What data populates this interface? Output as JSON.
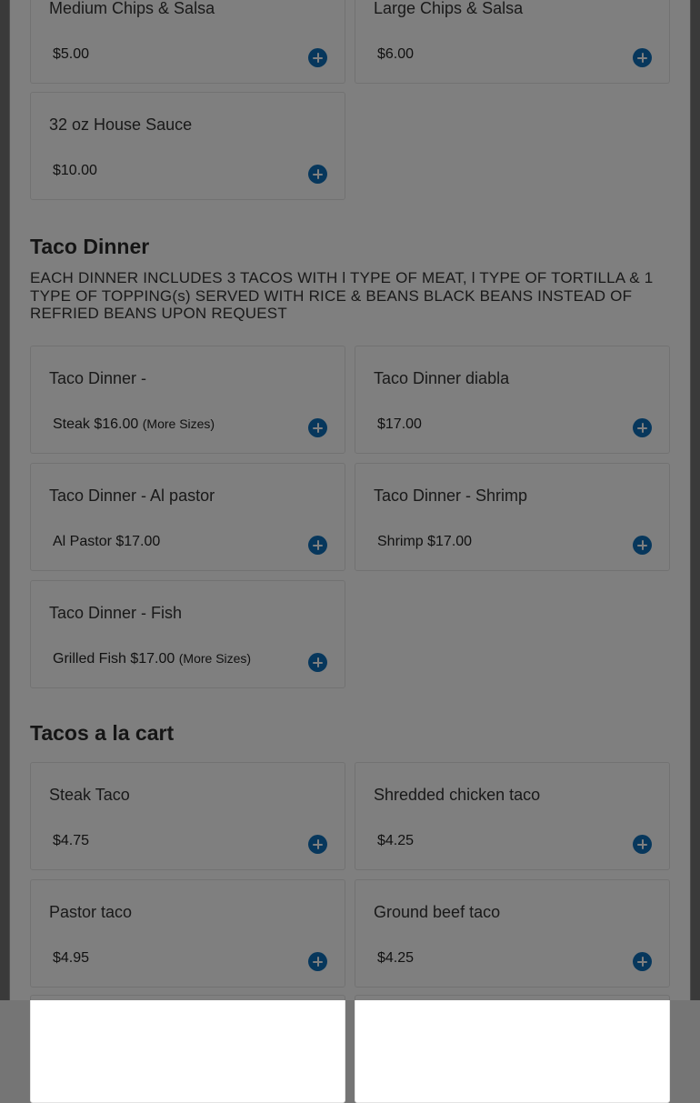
{
  "sections": [
    {
      "title": "",
      "items": [
        {
          "name": "Medium Chips & Salsa",
          "price": "$5.00",
          "more": ""
        },
        {
          "name": "Large Chips & Salsa",
          "price": "$6.00",
          "more": ""
        },
        {
          "name": "32 oz House Sauce",
          "price": "$10.00",
          "more": ""
        }
      ]
    },
    {
      "title": "Taco Dinner",
      "description": "EACH DINNER INCLUDES 3 TACOS WITH l TYPE OF MEAT, l TYPE OF TORTILLA & 1 TYPE OF TOPPING(s) SERVED WITH RICE & BEANS BLACK BEANS INSTEAD OF REFRIED BEANS UPON REQUEST",
      "items": [
        {
          "name": "Taco Dinner -",
          "price": "Steak $16.00",
          "more": "(More Sizes)"
        },
        {
          "name": "Taco Dinner diabla",
          "price": "$17.00",
          "more": ""
        },
        {
          "name": "Taco Dinner - Al pastor",
          "price": "Al Pastor $17.00",
          "more": ""
        },
        {
          "name": "Taco Dinner - Shrimp",
          "price": "Shrimp $17.00",
          "more": ""
        },
        {
          "name": "Taco Dinner - Fish",
          "price": "Grilled Fish $17.00",
          "more": "(More Sizes)"
        }
      ]
    },
    {
      "title": "Tacos a la cart",
      "items": [
        {
          "name": "Steak Taco",
          "price": "$4.75",
          "more": ""
        },
        {
          "name": "Shredded chicken taco",
          "price": "$4.25",
          "more": ""
        },
        {
          "name": "Pastor taco",
          "price": "$4.95",
          "more": ""
        },
        {
          "name": "Ground beef taco",
          "price": "$4.25",
          "more": ""
        }
      ]
    }
  ],
  "icons": {
    "add": "plus-circle-icon"
  },
  "colors": {
    "accent": "#0f6fb9",
    "overlay": "rgba(0,0,0,0.5)",
    "background": "#ffffff"
  }
}
